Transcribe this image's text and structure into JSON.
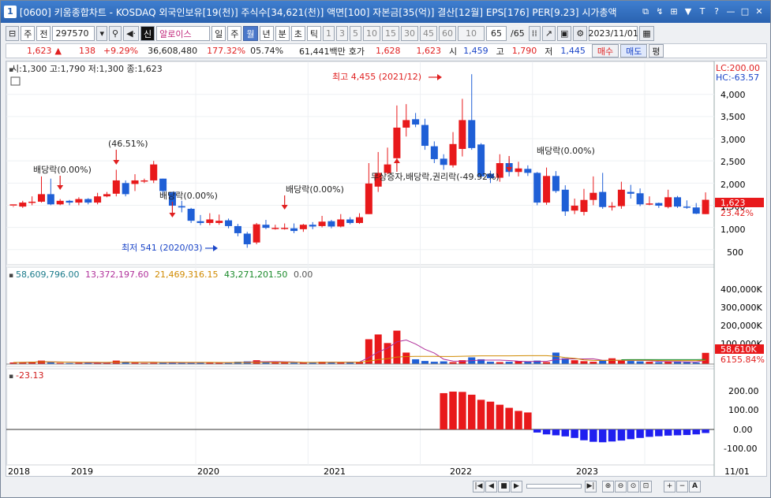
{
  "window": {
    "number": "1",
    "title": "[0600] 키움종합차트 - KOSDAQ 외국인보유[19(천)] 주식수[34,621(천)] 액면[100] 자본금[35(억)] 결산[12월] EPS[176] PER[9.23] 시가총액",
    "buttons": [
      "⧉",
      "↯",
      "⊞",
      "▼",
      "T",
      "?",
      "—",
      "□",
      "✕"
    ]
  },
  "toolbar": {
    "mode1": "주",
    "mode2": "전",
    "code": "297570",
    "signal": "신",
    "name": "알로이스",
    "periods": [
      "일",
      "주",
      "월",
      "년",
      "분",
      "초",
      "틱"
    ],
    "period_selected": "월",
    "intervals": [
      "1",
      "3",
      "5",
      "10",
      "15",
      "30",
      "45",
      "60"
    ],
    "interval_value": "10",
    "count": "65",
    "count_total": "/65",
    "date": "2023/11/01"
  },
  "quote": {
    "price": "1,623",
    "arrow": "▲",
    "change": "138",
    "change_pct": "+9.29%",
    "volume": "36,608,480",
    "vol_ratio": "177.32%",
    "turnover": "05.74%",
    "amount": "61,441백만",
    "hoga_label": "호가",
    "ask": "1,628",
    "bid": "1,623",
    "open_label": "시",
    "open": "1,459",
    "high_label": "고",
    "high": "1,790",
    "low_label": "저",
    "low": "1,445",
    "buy": "매수",
    "sell": "매도",
    "eval": "평"
  },
  "price_panel": {
    "legend": "시:1,300 고:1,790 저:1,300 종:1,623",
    "lc": "LC:200.00",
    "hc": "HC:-63.57",
    "ticks": [
      "4,000",
      "3,500",
      "3,000",
      "2,500",
      "2,000",
      "1,500",
      "1,000",
      "500"
    ],
    "current_price": "1,623",
    "current_pct": "23.42%",
    "annotations": {
      "high": "최고 4,455 (2021/12)",
      "low": "최저 541 (2020/03)",
      "div1": "배당락(0.00%)",
      "pct1": "(46.51%)",
      "div2": "배당락(0.00%)",
      "div3": "배당락(0.00%)",
      "div4": "배당락(0.00%)",
      "bonus": "무상증자,배당락,권리락(-49.92%)"
    }
  },
  "volume_panel": {
    "legend": [
      "58,609,796.00",
      "13,372,197.60",
      "21,469,316.15",
      "43,271,201.50",
      "0.00"
    ],
    "legend_colors": [
      "#1a7a8a",
      "#b0309a",
      "#d08a00",
      "#1a8a2a",
      "#555555"
    ],
    "ticks": [
      "400,000K",
      "300,000K",
      "200,000K",
      "100,000K"
    ],
    "current": "58,610K",
    "current_pct": "6155.84%"
  },
  "osc_panel": {
    "legend": "-23.13",
    "ticks": [
      "200.00",
      "100.00",
      "0.00",
      "-100.00"
    ]
  },
  "xaxis": {
    "labels": [
      "2018",
      "2019",
      "2020",
      "2021",
      "2022",
      "2023"
    ],
    "end_label": "11/01"
  },
  "colors": {
    "up": "#e8191b",
    "down": "#1f5fd6",
    "accent": "#2a62b0"
  },
  "chart_data": {
    "type": "candlestick",
    "x_start": "2018/05",
    "x_end": "2023/11",
    "ylim": [
      300,
      4600
    ],
    "candles": [
      [
        1500,
        1520,
        1480,
        1460
      ],
      [
        1470,
        1560,
        1600,
        1440
      ],
      [
        1560,
        1580,
        1700,
        1500
      ],
      [
        1580,
        1750,
        2150,
        1560
      ],
      [
        1750,
        1520,
        2100,
        1500
      ],
      [
        1520,
        1600,
        1640,
        1500
      ],
      [
        1600,
        1560,
        1620,
        1500
      ],
      [
        1560,
        1640,
        1680,
        1500
      ],
      [
        1640,
        1560,
        1660,
        1520
      ],
      [
        1560,
        1700,
        1780,
        1520
      ],
      [
        1700,
        1750,
        1800,
        1680
      ],
      [
        1760,
        2060,
        2300,
        1700
      ],
      [
        2000,
        1750,
        2060,
        1700
      ],
      [
        1980,
        2060,
        2200,
        1820
      ],
      [
        2060,
        2060,
        2100,
        2000
      ],
      [
        2060,
        2420,
        2500,
        2000
      ],
      [
        2100,
        1820,
        2100,
        1700
      ],
      [
        1800,
        1490,
        1800,
        1440
      ],
      [
        1480,
        1450,
        1600,
        1340
      ],
      [
        1420,
        1150,
        1440,
        1100
      ],
      [
        1140,
        1100,
        1280,
        1050
      ],
      [
        1100,
        1180,
        1320,
        1050
      ],
      [
        1100,
        1150,
        1290,
        1060
      ],
      [
        1160,
        1030,
        1200,
        980
      ],
      [
        1030,
        870,
        1080,
        800
      ],
      [
        860,
        620,
        900,
        541
      ],
      [
        660,
        1070,
        1100,
        620
      ],
      [
        1060,
        990,
        1170,
        960
      ],
      [
        990,
        990,
        1060,
        950
      ],
      [
        990,
        990,
        1090,
        950
      ],
      [
        980,
        920,
        1090,
        870
      ],
      [
        960,
        1060,
        1080,
        900
      ],
      [
        1060,
        1020,
        1120,
        960
      ],
      [
        1030,
        1130,
        1260,
        1000
      ],
      [
        1140,
        1020,
        1170,
        980
      ],
      [
        1020,
        1180,
        1300,
        1000
      ],
      [
        1180,
        1100,
        1230,
        1070
      ],
      [
        1100,
        1230,
        1320,
        1080
      ],
      [
        1300,
        1990,
        2450,
        1300
      ],
      [
        1920,
        2230,
        2700,
        1800
      ],
      [
        2230,
        2420,
        2800,
        2200
      ],
      [
        2560,
        3250,
        3750,
        2400
      ],
      [
        3250,
        3420,
        3780,
        3050
      ],
      [
        3440,
        3320,
        3580,
        3260
      ],
      [
        3310,
        2840,
        3450,
        2750
      ],
      [
        2830,
        2540,
        2940,
        2450
      ],
      [
        2550,
        2410,
        2650,
        2300
      ],
      [
        2400,
        2880,
        3150,
        2350
      ],
      [
        2770,
        3420,
        3900,
        2600
      ],
      [
        3420,
        2790,
        4455,
        2750
      ],
      [
        2870,
        2150,
        2900,
        2100
      ],
      [
        2210,
        2110,
        2280,
        2000
      ],
      [
        2120,
        2450,
        2650,
        2030
      ],
      [
        2450,
        2250,
        2550,
        2150
      ],
      [
        2250,
        2330,
        2480,
        2150
      ],
      [
        2320,
        2230,
        2400,
        2160
      ],
      [
        2230,
        1560,
        2250,
        1500
      ],
      [
        1560,
        2160,
        2350,
        1510
      ],
      [
        2160,
        1820,
        2270,
        1780
      ],
      [
        1850,
        1360,
        1950,
        1260
      ],
      [
        1380,
        1490,
        1650,
        1300
      ],
      [
        1350,
        1620,
        1870,
        1270
      ],
      [
        1620,
        1780,
        2150,
        1500
      ],
      [
        1800,
        1460,
        2230,
        1420
      ],
      [
        1460,
        1480,
        1570,
        1380
      ],
      [
        1480,
        1850,
        2030,
        1420
      ],
      [
        1800,
        1760,
        1960,
        1650
      ],
      [
        1770,
        1520,
        1880,
        1480
      ],
      [
        1520,
        1540,
        1700,
        1500
      ],
      [
        1550,
        1490,
        1560,
        1440
      ],
      [
        1460,
        1680,
        1850,
        1430
      ],
      [
        1680,
        1470,
        1710,
        1440
      ],
      [
        1470,
        1460,
        1610,
        1420
      ],
      [
        1450,
        1310,
        1550,
        1300
      ],
      [
        1300,
        1623,
        1790,
        1300
      ]
    ],
    "volume_M": [
      8,
      10,
      12,
      18,
      9,
      6,
      5,
      6,
      10,
      7,
      6,
      18,
      12,
      7,
      5,
      6,
      8,
      10,
      7,
      6,
      8,
      9,
      7,
      6,
      12,
      14,
      20,
      10,
      8,
      8,
      7,
      9,
      8,
      12,
      10,
      8,
      10,
      12,
      130,
      155,
      110,
      175,
      60,
      25,
      16,
      12,
      14,
      10,
      20,
      35,
      25,
      12,
      10,
      12,
      16,
      14,
      18,
      10,
      60,
      30,
      20,
      15,
      12,
      20,
      30,
      18,
      16,
      14,
      12,
      10,
      12,
      14,
      10,
      8,
      58.6
    ],
    "osc": [
      235,
      245,
      243,
      225,
      192,
      180,
      160,
      140,
      120,
      110,
      -20,
      -32,
      -38,
      -45,
      -55,
      -70,
      -80,
      -83,
      -78,
      -72,
      -63,
      -55,
      -48,
      -44,
      -40,
      -38,
      -36,
      -32,
      -23.13
    ],
    "volume_ylim": [
      0,
      450
    ],
    "osc_ylim": [
      -140,
      280
    ]
  }
}
